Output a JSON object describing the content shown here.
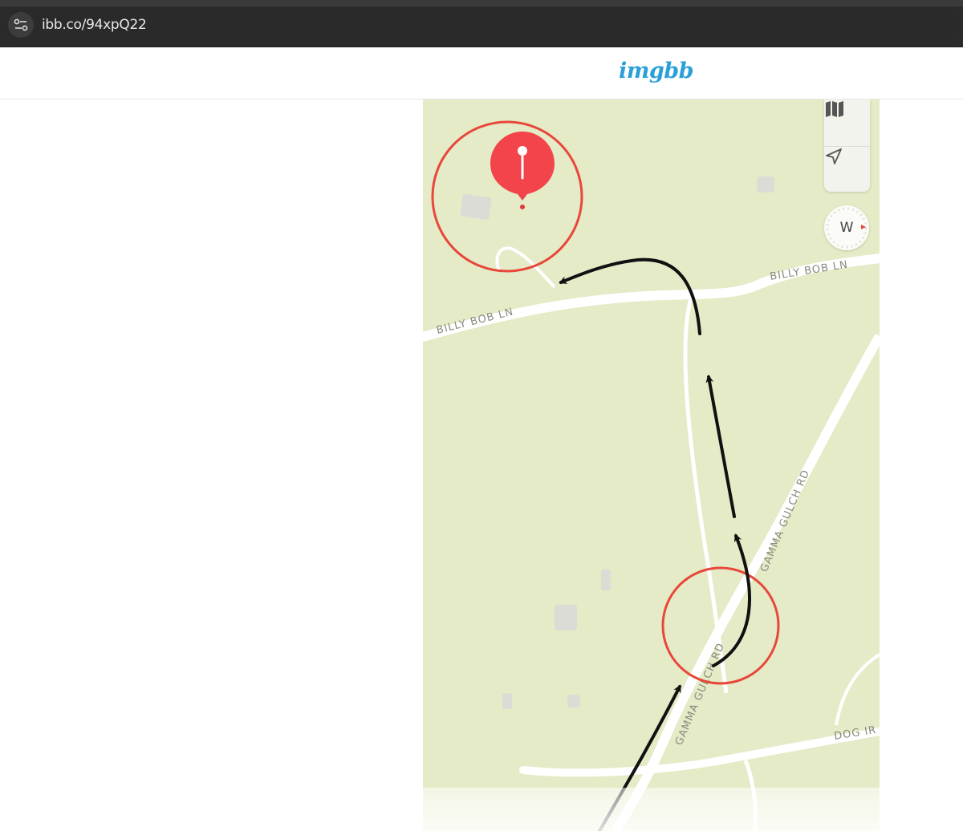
{
  "browser": {
    "url": "ibb.co/94xpQ22",
    "site_info_icon": "tune-icon"
  },
  "header": {
    "logo_text": "imgbb",
    "logo_color": "#2a9fd8"
  },
  "map": {
    "roads": {
      "billy_bob_left": "BILLY BOB LN",
      "billy_bob_right": "BILLY BOB LN",
      "gamma_gulch_upper": "GAMMA GULCH RD",
      "gamma_gulch_lower": "GAMMA GULCH RD",
      "dog": "DOG IR"
    },
    "compass_letter": "W",
    "controls": [
      "map-icon",
      "navigate-arrow-icon",
      "compass-icon"
    ],
    "marker_color": "#f2444a",
    "annotation_circle_color": "#e8473a",
    "annotation_arrow_color": "#111111"
  }
}
